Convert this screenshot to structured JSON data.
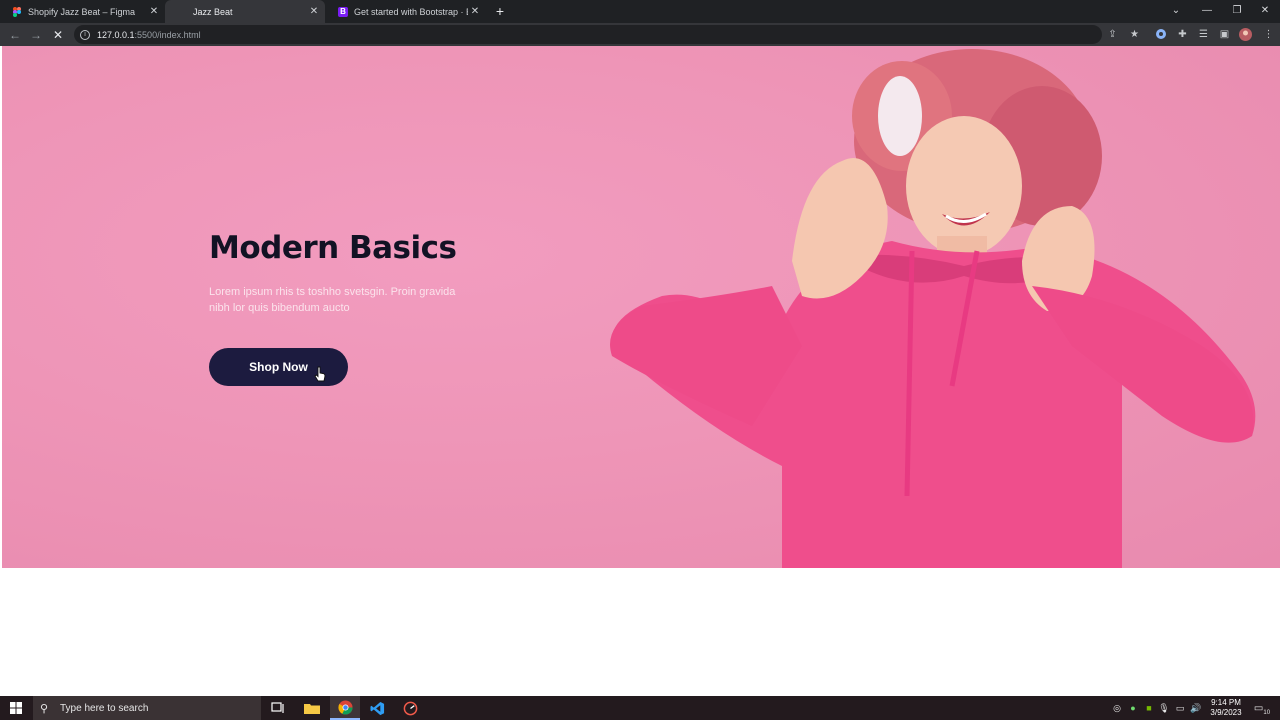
{
  "browser": {
    "tabs": [
      {
        "title": "Shopify Jazz Beat – Figma",
        "favicon": "figma-icon",
        "active": false
      },
      {
        "title": "Jazz Beat",
        "favicon": "loading-icon",
        "active": true
      },
      {
        "title": "Get started with Bootstrap · Boot",
        "favicon": "bootstrap-icon",
        "active": false
      }
    ],
    "new_tab": "+",
    "url_host": "127.0.0.1",
    "url_rest": ":5500/index.html"
  },
  "hero": {
    "title": "Modern Basics",
    "text": "Lorem ipsum rhis ts toshho svetsgin. Proin gravida nibh lor quis bibendum aucto",
    "button": "Shop Now",
    "bg_color": "#ee95b7",
    "button_color": "#1c1b3f"
  },
  "taskbar": {
    "search_placeholder": "Type here to search",
    "time": "9:14 PM",
    "date": "3/9/2023",
    "notification_count": "10"
  }
}
